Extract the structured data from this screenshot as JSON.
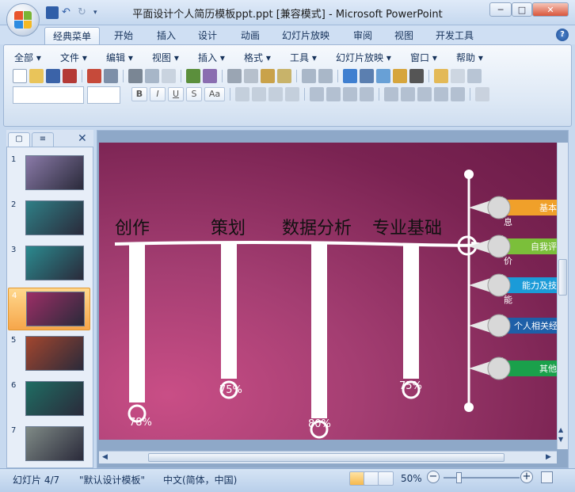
{
  "window": {
    "title": "平面设计个人简历模板ppt.ppt [兼容模式] - Microsoft PowerPoint",
    "minimize": "─",
    "maximize": "□",
    "close": "✕"
  },
  "ribbon_tabs": [
    "经典菜单",
    "开始",
    "插入",
    "设计",
    "动画",
    "幻灯片放映",
    "审阅",
    "视图",
    "开发工具"
  ],
  "help_label": "?",
  "classic_menu": [
    "全部 ▾",
    "文件 ▾",
    "编辑 ▾",
    "视图 ▾",
    "插入 ▾",
    "格式 ▾",
    "工具 ▾",
    "幻灯片放映 ▾",
    "窗口 ▾",
    "帮助 ▾"
  ],
  "format_buttons": [
    "B",
    "I",
    "U",
    "S",
    "Aa"
  ],
  "pane_close": "✕",
  "thumbnails": [
    {
      "num": "1",
      "color": "#8a7aa8"
    },
    {
      "num": "2",
      "color": "#2f7f86"
    },
    {
      "num": "3",
      "color": "#2b8a8f"
    },
    {
      "num": "4",
      "color": "#9c2e66"
    },
    {
      "num": "5",
      "color": "#a3462e"
    },
    {
      "num": "6",
      "color": "#1f6d63"
    },
    {
      "num": "7",
      "color": "#7f8a86"
    }
  ],
  "slide": {
    "columns": [
      {
        "label": "创作",
        "percent": "78%",
        "value": 78
      },
      {
        "label": "策划",
        "percent": "75%",
        "value": 75
      },
      {
        "label": "数据分析",
        "percent": "80%",
        "value": 80
      },
      {
        "label": "专业基础",
        "percent": "75%",
        "value": 75
      }
    ],
    "side_items": [
      {
        "label": "基本",
        "color": "#f0a02a",
        "sub": "息"
      },
      {
        "label": "自我评",
        "color": "#7bbf3a",
        "sub": "价"
      },
      {
        "label": "能力及技",
        "color": "#1b9bd8",
        "sub": "能"
      },
      {
        "label": "个人相关经",
        "color": "#1e5fa8",
        "sub": ""
      },
      {
        "label": "其他",
        "color": "#1aa04b",
        "sub": ""
      }
    ]
  },
  "status": {
    "slide_info": "幻灯片 4/7",
    "theme": "\"默认设计模板\"",
    "language": "中文(简体，中国)",
    "zoom": "50%"
  }
}
